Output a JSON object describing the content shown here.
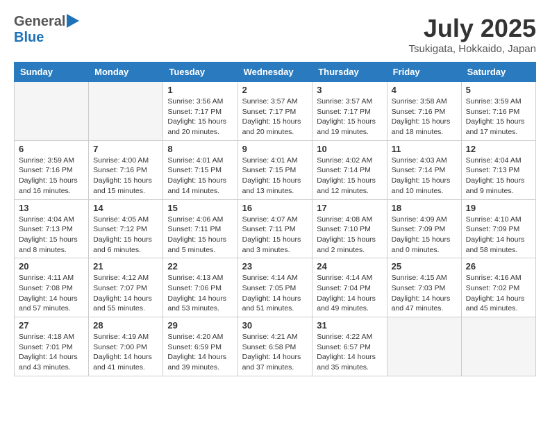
{
  "header": {
    "logo_general": "General",
    "logo_blue": "Blue",
    "month_title": "July 2025",
    "location": "Tsukigata, Hokkaido, Japan"
  },
  "days_of_week": [
    "Sunday",
    "Monday",
    "Tuesday",
    "Wednesday",
    "Thursday",
    "Friday",
    "Saturday"
  ],
  "weeks": [
    [
      {
        "day": "",
        "empty": true
      },
      {
        "day": "",
        "empty": true
      },
      {
        "day": "1",
        "sunrise": "3:56 AM",
        "sunset": "7:17 PM",
        "daylight": "15 hours and 20 minutes."
      },
      {
        "day": "2",
        "sunrise": "3:57 AM",
        "sunset": "7:17 PM",
        "daylight": "15 hours and 20 minutes."
      },
      {
        "day": "3",
        "sunrise": "3:57 AM",
        "sunset": "7:17 PM",
        "daylight": "15 hours and 19 minutes."
      },
      {
        "day": "4",
        "sunrise": "3:58 AM",
        "sunset": "7:16 PM",
        "daylight": "15 hours and 18 minutes."
      },
      {
        "day": "5",
        "sunrise": "3:59 AM",
        "sunset": "7:16 PM",
        "daylight": "15 hours and 17 minutes."
      }
    ],
    [
      {
        "day": "6",
        "sunrise": "3:59 AM",
        "sunset": "7:16 PM",
        "daylight": "15 hours and 16 minutes."
      },
      {
        "day": "7",
        "sunrise": "4:00 AM",
        "sunset": "7:16 PM",
        "daylight": "15 hours and 15 minutes."
      },
      {
        "day": "8",
        "sunrise": "4:01 AM",
        "sunset": "7:15 PM",
        "daylight": "15 hours and 14 minutes."
      },
      {
        "day": "9",
        "sunrise": "4:01 AM",
        "sunset": "7:15 PM",
        "daylight": "15 hours and 13 minutes."
      },
      {
        "day": "10",
        "sunrise": "4:02 AM",
        "sunset": "7:14 PM",
        "daylight": "15 hours and 12 minutes."
      },
      {
        "day": "11",
        "sunrise": "4:03 AM",
        "sunset": "7:14 PM",
        "daylight": "15 hours and 10 minutes."
      },
      {
        "day": "12",
        "sunrise": "4:04 AM",
        "sunset": "7:13 PM",
        "daylight": "15 hours and 9 minutes."
      }
    ],
    [
      {
        "day": "13",
        "sunrise": "4:04 AM",
        "sunset": "7:13 PM",
        "daylight": "15 hours and 8 minutes."
      },
      {
        "day": "14",
        "sunrise": "4:05 AM",
        "sunset": "7:12 PM",
        "daylight": "15 hours and 6 minutes."
      },
      {
        "day": "15",
        "sunrise": "4:06 AM",
        "sunset": "7:11 PM",
        "daylight": "15 hours and 5 minutes."
      },
      {
        "day": "16",
        "sunrise": "4:07 AM",
        "sunset": "7:11 PM",
        "daylight": "15 hours and 3 minutes."
      },
      {
        "day": "17",
        "sunrise": "4:08 AM",
        "sunset": "7:10 PM",
        "daylight": "15 hours and 2 minutes."
      },
      {
        "day": "18",
        "sunrise": "4:09 AM",
        "sunset": "7:09 PM",
        "daylight": "15 hours and 0 minutes."
      },
      {
        "day": "19",
        "sunrise": "4:10 AM",
        "sunset": "7:09 PM",
        "daylight": "14 hours and 58 minutes."
      }
    ],
    [
      {
        "day": "20",
        "sunrise": "4:11 AM",
        "sunset": "7:08 PM",
        "daylight": "14 hours and 57 minutes."
      },
      {
        "day": "21",
        "sunrise": "4:12 AM",
        "sunset": "7:07 PM",
        "daylight": "14 hours and 55 minutes."
      },
      {
        "day": "22",
        "sunrise": "4:13 AM",
        "sunset": "7:06 PM",
        "daylight": "14 hours and 53 minutes."
      },
      {
        "day": "23",
        "sunrise": "4:14 AM",
        "sunset": "7:05 PM",
        "daylight": "14 hours and 51 minutes."
      },
      {
        "day": "24",
        "sunrise": "4:14 AM",
        "sunset": "7:04 PM",
        "daylight": "14 hours and 49 minutes."
      },
      {
        "day": "25",
        "sunrise": "4:15 AM",
        "sunset": "7:03 PM",
        "daylight": "14 hours and 47 minutes."
      },
      {
        "day": "26",
        "sunrise": "4:16 AM",
        "sunset": "7:02 PM",
        "daylight": "14 hours and 45 minutes."
      }
    ],
    [
      {
        "day": "27",
        "sunrise": "4:18 AM",
        "sunset": "7:01 PM",
        "daylight": "14 hours and 43 minutes."
      },
      {
        "day": "28",
        "sunrise": "4:19 AM",
        "sunset": "7:00 PM",
        "daylight": "14 hours and 41 minutes."
      },
      {
        "day": "29",
        "sunrise": "4:20 AM",
        "sunset": "6:59 PM",
        "daylight": "14 hours and 39 minutes."
      },
      {
        "day": "30",
        "sunrise": "4:21 AM",
        "sunset": "6:58 PM",
        "daylight": "14 hours and 37 minutes."
      },
      {
        "day": "31",
        "sunrise": "4:22 AM",
        "sunset": "6:57 PM",
        "daylight": "14 hours and 35 minutes."
      },
      {
        "day": "",
        "empty": true
      },
      {
        "day": "",
        "empty": true
      }
    ]
  ]
}
